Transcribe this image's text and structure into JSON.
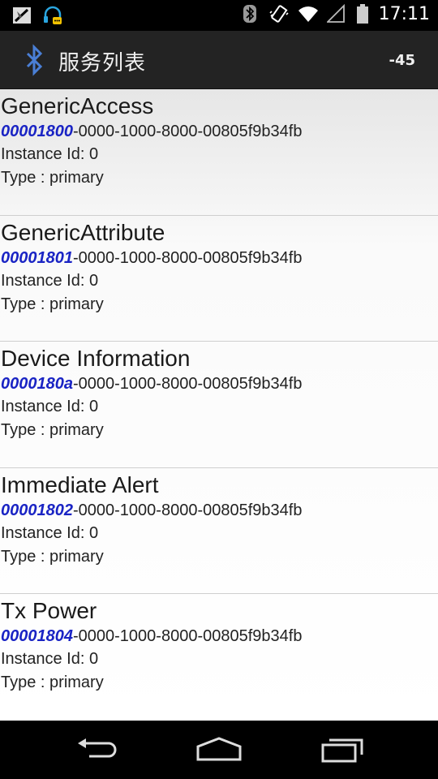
{
  "status_bar": {
    "left_icons": [
      "no-sim-icon",
      "headset-chat-icon"
    ],
    "right_icons": [
      "bluetooth-icon",
      "vibrate-icon",
      "wifi-icon",
      "signal-icon",
      "battery-icon"
    ],
    "time": "17:11"
  },
  "action_bar": {
    "icon": "bluetooth-icon",
    "title": "服务列表",
    "rssi": "-45"
  },
  "services": [
    {
      "name": "GenericAccess",
      "uuid_short": "00001800",
      "uuid_rest": "-0000-1000-8000-00805f9b34fb",
      "instance": "Instance Id: 0",
      "type": "Type : primary"
    },
    {
      "name": "GenericAttribute",
      "uuid_short": "00001801",
      "uuid_rest": "-0000-1000-8000-00805f9b34fb",
      "instance": "Instance Id: 0",
      "type": "Type : primary"
    },
    {
      "name": "Device Information",
      "uuid_short": "0000180a",
      "uuid_rest": "-0000-1000-8000-00805f9b34fb",
      "instance": "Instance Id: 0",
      "type": "Type : primary"
    },
    {
      "name": "Immediate Alert",
      "uuid_short": "00001802",
      "uuid_rest": "-0000-1000-8000-00805f9b34fb",
      "instance": "Instance Id: 0",
      "type": "Type : primary"
    },
    {
      "name": "Tx Power",
      "uuid_short": "00001804",
      "uuid_rest": "-0000-1000-8000-00805f9b34fb",
      "instance": "Instance Id: 0",
      "type": "Type : primary"
    }
  ],
  "nav_bar": {
    "buttons": [
      "back-icon",
      "home-icon",
      "recents-icon"
    ]
  },
  "colors": {
    "uuid_accent": "#1a24c4",
    "action_bar_bg": "#232323"
  }
}
